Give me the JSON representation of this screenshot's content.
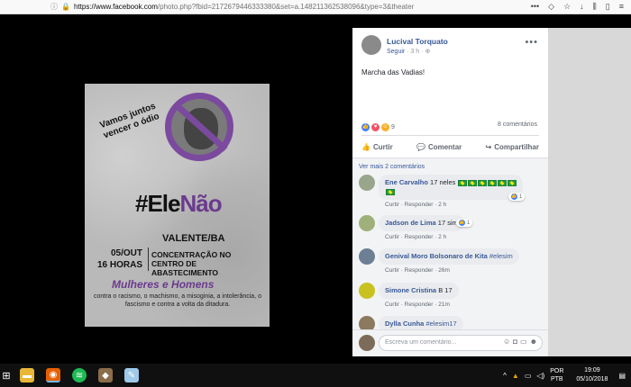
{
  "browser": {
    "url": "https://www.facebook.com/photo.php?fbid=2172679446333380&set=a.148211362538096&type=3&theater",
    "url_host": "https://www.facebook.com",
    "url_rest": "/photo.php?fbid=2172679446333380&set=a.148211362538096&type=3&theater",
    "lock_icon": "lock-icon",
    "info_icon": "info-icon"
  },
  "poster": {
    "scrawl": "Vamos juntos vencer o ódio",
    "hashtag_prefix": "#Ele",
    "hashtag_suffix": "Não",
    "city": "VALENTE/BA",
    "date": "05/OUT",
    "time": "16 HORAS",
    "location": "CONCENTRAÇÃO NO CENTRO DE ABASTECIMENTO",
    "audience": "Mulheres e Homens",
    "against": "contra o racismo, o machismo, a misoginia, a intolerância, o fascismo e contra a volta da ditadura."
  },
  "post": {
    "author": "Lucival Torquato",
    "follow": "Seguir",
    "time": "3 h",
    "caption": "Marcha das Vadias!",
    "reaction_count": "9",
    "comment_count": "8 comentários",
    "actions": {
      "like": "Curtir",
      "comment": "Comentar",
      "share": "Compartilhar"
    }
  },
  "comments": {
    "view_more": "Ver mais 2 comentários",
    "items": [
      {
        "name": "Ene Carvalho",
        "text": "17 neles",
        "meta": "Curtir · Responder · 2 h",
        "likes": "1"
      },
      {
        "name": "Jadson de Lima",
        "text": "17 sim",
        "meta": "Curtir · Responder · 2 h",
        "likes": "1"
      },
      {
        "name": "Genival Moro Bolsonaro de Kita",
        "tag": "#elesim",
        "meta": "Curtir · Responder · 26m"
      },
      {
        "name": "Simone Cristina",
        "text": "B 17",
        "meta": "Curtir · Responder · 21m"
      },
      {
        "name": "Dylla Cunha",
        "tag": "#elesim17"
      }
    ],
    "reply_placeholder": "Escreva um comentário..."
  },
  "taskbar": {
    "lang_top": "POR",
    "lang_bottom": "PTB",
    "time": "19:09",
    "date": "05/10/2018"
  },
  "colors": {
    "facebook_blue": "#385898",
    "purple": "#6b3a8e",
    "like_blue": "#4080ff"
  }
}
